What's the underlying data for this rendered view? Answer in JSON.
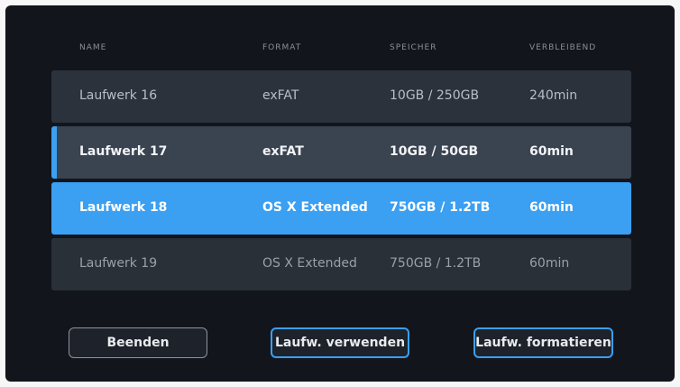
{
  "header": {
    "name": "NAME",
    "format": "FORMAT",
    "storage": "SPEICHER",
    "remaining": "VERBLEIBEND"
  },
  "drives": [
    {
      "name": "Laufwerk 16",
      "format": "exFAT",
      "storage": "10GB / 250GB",
      "remaining": "240min",
      "state": "normal"
    },
    {
      "name": "Laufwerk 17",
      "format": "exFAT",
      "storage": "10GB / 50GB",
      "remaining": "60min",
      "state": "selected"
    },
    {
      "name": "Laufwerk 18",
      "format": "OS X Extended",
      "storage": "750GB / 1.2TB",
      "remaining": "60min",
      "state": "active"
    },
    {
      "name": "Laufwerk 19",
      "format": "OS X Extended",
      "storage": "750GB / 1.2TB",
      "remaining": "60min",
      "state": "dim"
    }
  ],
  "buttons": {
    "quit": "Beenden",
    "use": "Laufw. verwenden",
    "format": "Laufw. formatieren"
  },
  "colors": {
    "accent": "#3b9ff2",
    "background": "#12151c",
    "row": "#2b323c"
  }
}
